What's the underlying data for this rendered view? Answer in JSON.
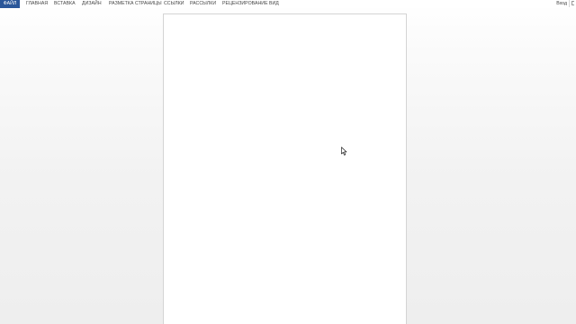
{
  "ribbon": {
    "tabs": [
      {
        "label": "ФАЙЛ",
        "active": true
      },
      {
        "label": "ГЛАВНАЯ"
      },
      {
        "label": "ВСТАВКА"
      },
      {
        "label": "ДИЗАЙН"
      },
      {
        "label": "РАЗМЕТКА СТРАНИЦЫ"
      },
      {
        "label": "ССЫЛКИ"
      },
      {
        "label": "РАССЫЛКИ"
      },
      {
        "label": "РЕЦЕНЗИРОВАНИЕ"
      },
      {
        "label": "ВИД"
      }
    ],
    "account_label": "Вход"
  },
  "colors": {
    "file_tab_background": "#2b579a",
    "file_tab_text": "#ffffff",
    "tab_text": "#444444",
    "workspace": "#f2f2f2",
    "page": "#ffffff"
  },
  "icons": {
    "cursor": "mouse-pointer-icon"
  }
}
